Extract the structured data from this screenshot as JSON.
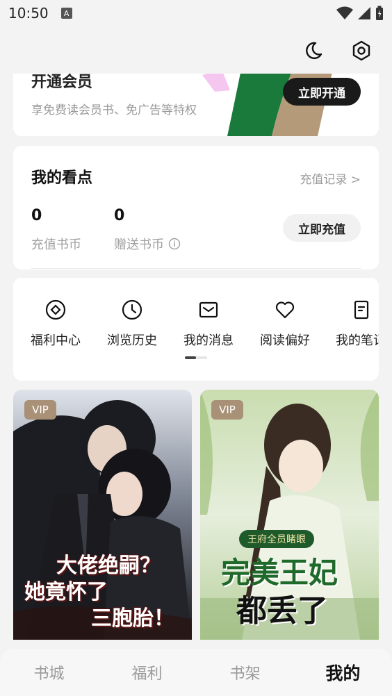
{
  "status_bar": {
    "time": "10:50",
    "badge": "A"
  },
  "top_bar": {
    "icons": [
      "moon-icon",
      "settings-icon"
    ]
  },
  "vip": {
    "title": "开通会员",
    "subtitle": "享免费读会员书、免广告等特权",
    "button": "立即开通"
  },
  "points": {
    "title": "我的看点",
    "record_link": "充值记录 >",
    "recharge_value": "0",
    "recharge_label": "充值书币",
    "gift_value": "0",
    "gift_label": "赠送书币",
    "button": "立即充值"
  },
  "menu": {
    "items": [
      {
        "label": "福利中心",
        "icon": "diamond-coin-icon"
      },
      {
        "label": "浏览历史",
        "icon": "clock-icon"
      },
      {
        "label": "我的消息",
        "icon": "mail-icon"
      },
      {
        "label": "阅读偏好",
        "icon": "heart-icon"
      },
      {
        "label": "我的笔记",
        "icon": "note-icon"
      }
    ]
  },
  "books": [
    {
      "tag": "VIP",
      "cover_text": [
        "大佬绝嗣？",
        "她竟怀了",
        "三胞胎！"
      ]
    },
    {
      "tag": "VIP",
      "cover_banner": "王府全员睹眼",
      "cover_text": [
        "完美王妃",
        "都丢了"
      ]
    }
  ],
  "colors": {
    "accent_dark": "#1a1a1a",
    "vip_tag": "#a89177",
    "vip_green": "#1a7a3c",
    "vip_tan": "#b59a7a"
  },
  "bottom_nav": {
    "items": [
      "书城",
      "福利",
      "书架",
      "我的"
    ],
    "active": "我的"
  }
}
